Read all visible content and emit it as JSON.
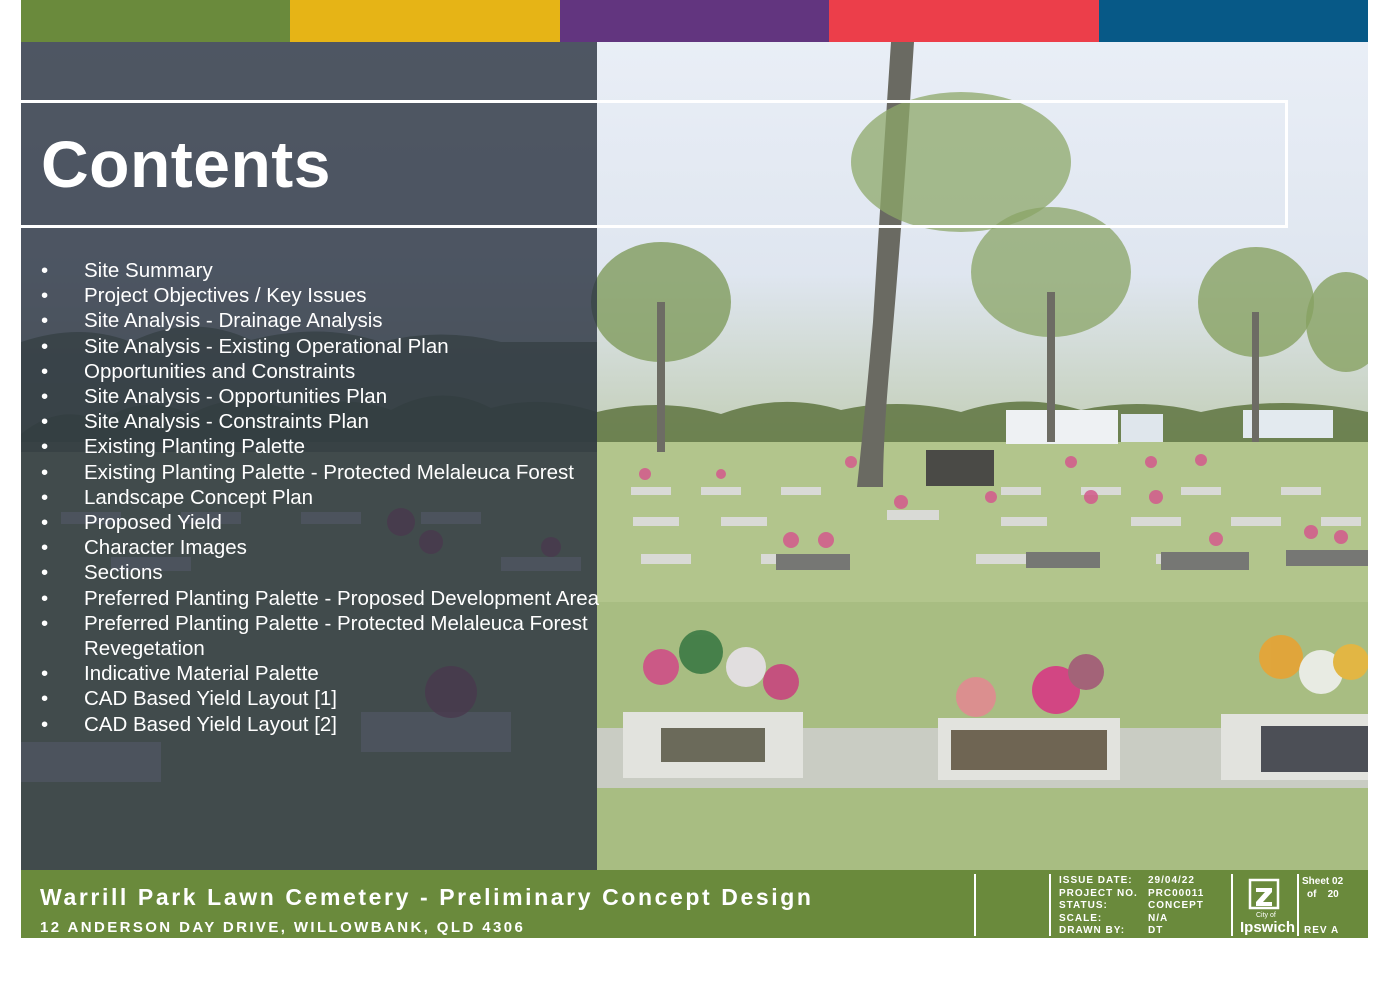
{
  "stripes": [
    "#6a8a3c",
    "#e6b416",
    "#62357f",
    "#ec3e4a",
    "#075987"
  ],
  "page_title": "Contents",
  "toc_bullet": "•",
  "toc_items": [
    "Site Summary",
    "Project Objectives / Key Issues",
    "Site Analysis - Drainage Analysis",
    "Site Analysis - Existing Operational Plan",
    "Opportunities and Constraints",
    "Site Analysis - Opportunities Plan",
    "Site Analysis - Constraints Plan",
    "Existing Planting Palette",
    "Existing Planting Palette - Protected Melaleuca Forest",
    "Landscape Concept Plan",
    "Proposed Yield",
    "Character Images",
    "Sections",
    "Preferred Planting Palette - Proposed Development Area",
    "Preferred Planting Palette - Protected Melaleuca Forest Revegetation",
    "Indicative Material Palette",
    "CAD Based Yield Layout [1]",
    "CAD Based Yield Layout [2]"
  ],
  "footer": {
    "project_title": "Warrill Park Lawn Cemetery - Preliminary Concept Design",
    "address": "12 ANDERSON DAY DRIVE, WILLOWBANK, QLD 4306",
    "meta": [
      {
        "label": "ISSUE DATE:",
        "value": "29/04/22"
      },
      {
        "label": "PROJECT NO.",
        "value": "PRC00011"
      },
      {
        "label": "STATUS:",
        "value": "CONCEPT"
      },
      {
        "label": "SCALE:",
        "value": "N/A"
      },
      {
        "label": "DRAWN BY:",
        "value": "DT"
      }
    ],
    "logo_small": "City of",
    "logo_text": "Ipswich",
    "sheet_label": "Sheet",
    "sheet_no": "02",
    "sheet_of": "of",
    "sheet_total": "20",
    "rev": "REV  A"
  }
}
